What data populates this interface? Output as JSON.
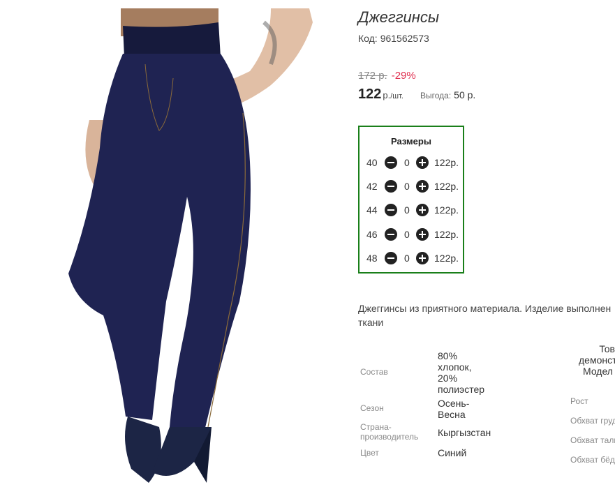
{
  "product": {
    "title": "Джеггинсы",
    "code_label": "Код:",
    "code": "961562573",
    "old_price": "172 р.",
    "discount": "-29%",
    "price": "122",
    "price_unit": "р.",
    "price_per": "/шт.",
    "benefit_label": "Выгода:",
    "benefit_value": "50 р."
  },
  "sizes": {
    "heading": "Размеры",
    "rows": [
      {
        "size": "40",
        "qty": "0",
        "price": "122р."
      },
      {
        "size": "42",
        "qty": "0",
        "price": "122р."
      },
      {
        "size": "44",
        "qty": "0",
        "price": "122р."
      },
      {
        "size": "46",
        "qty": "0",
        "price": "122р."
      },
      {
        "size": "48",
        "qty": "0",
        "price": "122р."
      }
    ]
  },
  "description": {
    "line1": "Джеггинсы из приятного материала. Изделие выполнен",
    "line2": "ткани"
  },
  "attributes": {
    "composition_label": "Состав",
    "composition_lines": [
      "80%",
      "хлопок,",
      "20%",
      "полиэстер"
    ],
    "season_label": "Сезон",
    "season_lines": [
      "Осень-",
      "Весна"
    ],
    "country_label_lines": [
      "Страна-",
      "производитель"
    ],
    "country_value": "Кыргызстан",
    "color_label": "Цвет",
    "color_value": "Синий"
  },
  "model": {
    "lines": [
      "Тов",
      "демонст",
      "Модел"
    ],
    "height_label": "Рост",
    "chest_label": "Обхват груд",
    "waist_label": "Обхват тали",
    "hips_label": "Обхват бёдр"
  },
  "colors": {
    "accent_discount": "#e03050",
    "sizes_border": "#1a7f1a",
    "jeans": "#1f2352"
  }
}
